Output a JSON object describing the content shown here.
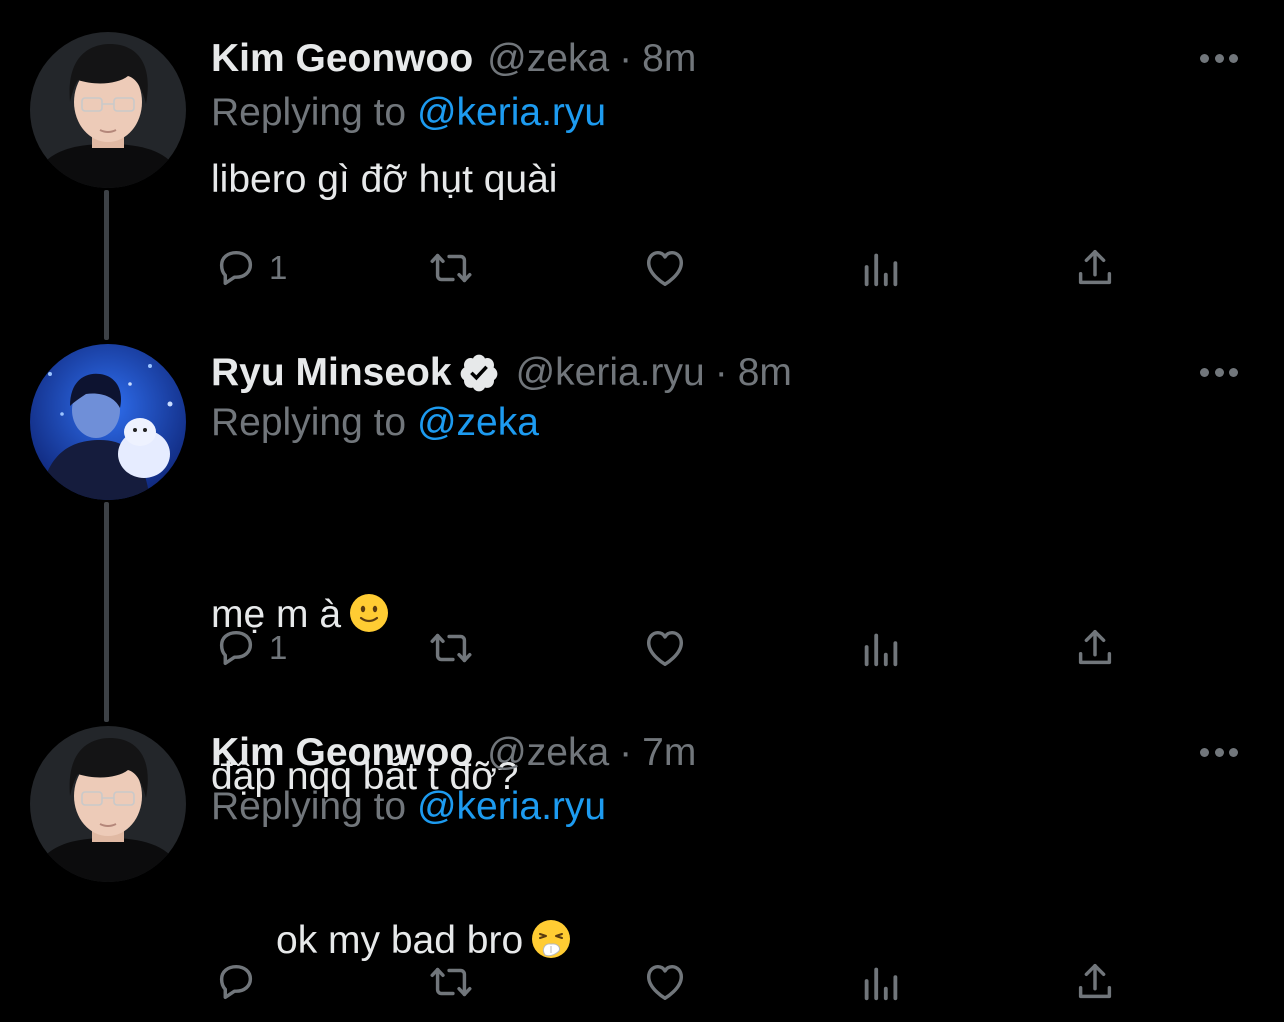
{
  "colors": {
    "background": "#000000",
    "primary_text": "#e7e9ea",
    "secondary_text": "#71767b",
    "accent": "#1d9bf0",
    "thread_line": "#3d4146"
  },
  "tweets": [
    {
      "author_name": "Kim Geonwoo",
      "handle": "@zeka",
      "separator": "·",
      "time": "8m",
      "verified": false,
      "replying_prefix": "Replying to",
      "replying_to": "@keria.ryu",
      "text": "libero gì đỡ hụt quài",
      "emoji": "",
      "reply_count": "1",
      "icons": [
        "reply-icon",
        "retweet-icon",
        "like-icon",
        "analytics-icon",
        "share-icon"
      ]
    },
    {
      "author_name": "Ryu Minseok",
      "handle": "@keria.ryu",
      "separator": "·",
      "time": "8m",
      "verified": true,
      "replying_prefix": "Replying to",
      "replying_to": "@zeka",
      "text_line1": "mẹ m à",
      "emoji_line1": "slightly-smiling-face",
      "text_line2": "đập nqq bắt t đỡ?",
      "reply_count": "1",
      "icons": [
        "reply-icon",
        "retweet-icon",
        "like-icon",
        "analytics-icon",
        "share-icon"
      ]
    },
    {
      "author_name": "Kim Geonwoo",
      "handle": "@zeka",
      "separator": "·",
      "time": "7m",
      "verified": false,
      "replying_prefix": "Replying to",
      "replying_to": "@keria.ryu",
      "text": "ok my bad bro",
      "emoji": "sneezing-face",
      "reply_count": "",
      "icons": [
        "reply-icon",
        "retweet-icon",
        "like-icon",
        "analytics-icon",
        "share-icon"
      ]
    }
  ]
}
